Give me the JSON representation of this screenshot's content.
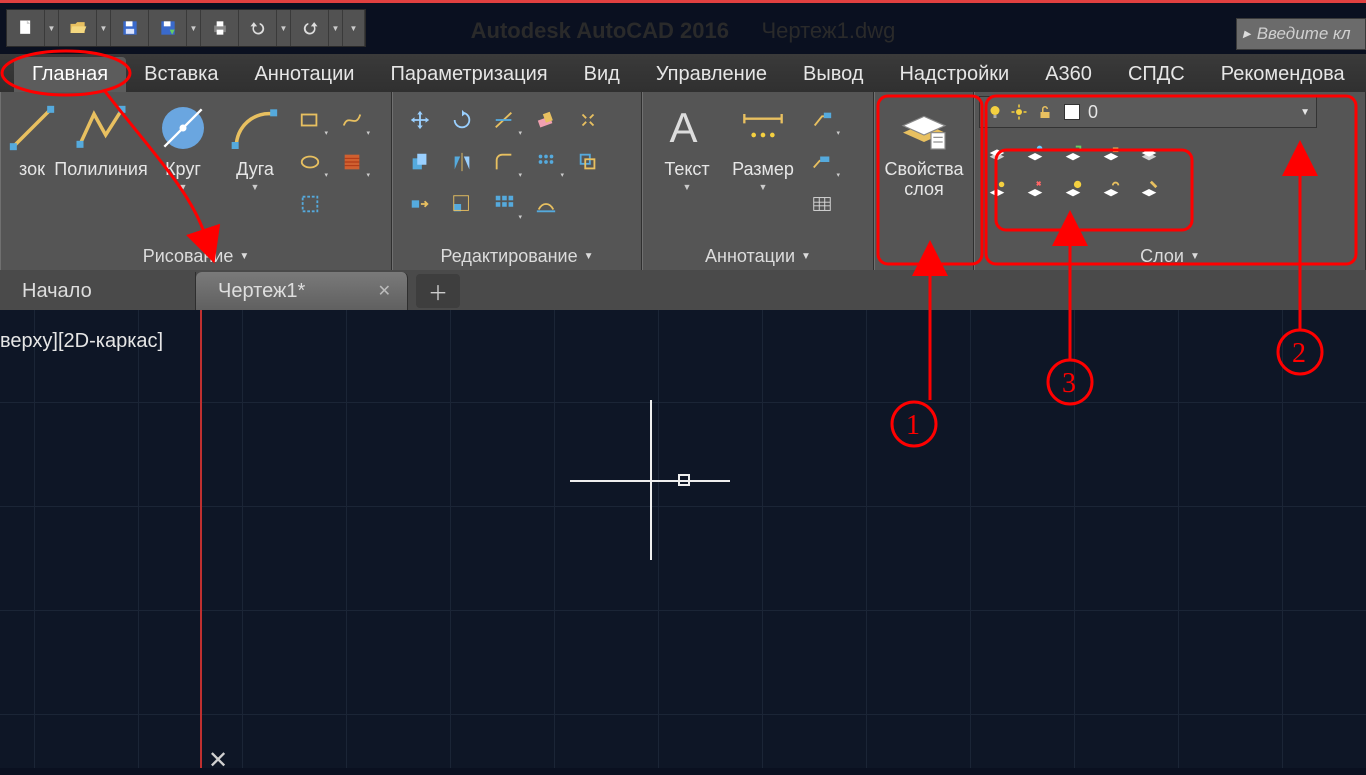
{
  "app": {
    "name": "Autodesk AutoCAD 2016",
    "file": "Чертеж1.dwg",
    "search_placeholder": "Введите кл"
  },
  "tabs": {
    "items": [
      "Главная",
      "Вставка",
      "Аннотации",
      "Параметризация",
      "Вид",
      "Управление",
      "Вывод",
      "Надстройки",
      "A360",
      "СПДС",
      "Рекомендова"
    ],
    "active": 0
  },
  "panels": {
    "draw": {
      "title": "Рисование",
      "polyline": "Полилиния",
      "circle": "Круг",
      "arc": "Дуга",
      "section": "зок"
    },
    "modify": {
      "title": "Редактирование"
    },
    "annot": {
      "title": "Аннотации",
      "text": "Текст",
      "dim": "Размер"
    },
    "layers": {
      "title": "Слои",
      "props": "Свойства\nслоя",
      "current": "0"
    }
  },
  "doctabs": {
    "home": "Начало",
    "active": "Чертеж1*"
  },
  "canvas": {
    "viewlabel": "верху][2D-каркас]"
  },
  "anno": {
    "n1": "1",
    "n2": "2",
    "n3": "3"
  }
}
